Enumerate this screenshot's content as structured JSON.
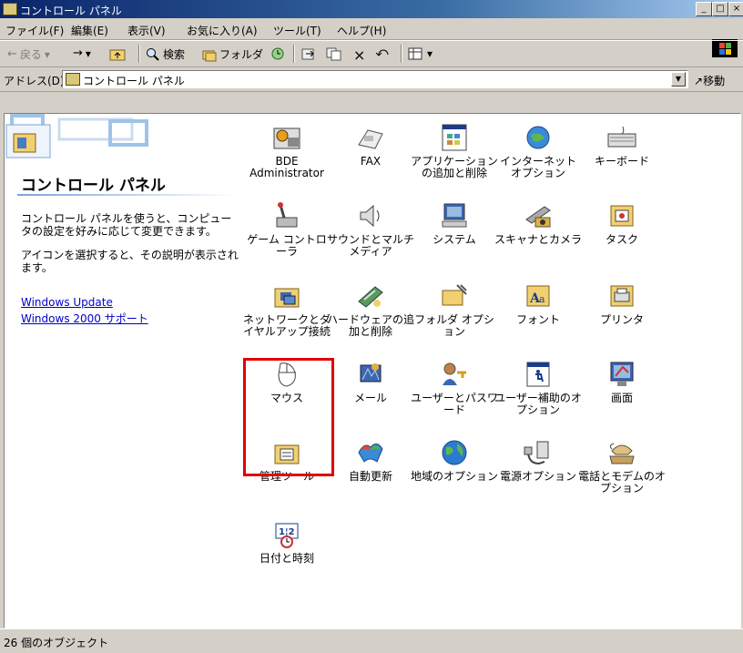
{
  "window": {
    "title": "コントロール パネル",
    "minimize": "_",
    "maximize": "□",
    "close": "×"
  },
  "menu": [
    "ファイル(F)",
    "編集(E)",
    "表示(V)",
    "お気に入り(A)",
    "ツール(T)",
    "ヘルプ(H)"
  ],
  "toolbar": {
    "back": "戻る",
    "forward": "→",
    "up": "",
    "search": "検索",
    "folders": "フォルダ",
    "history": "",
    "move_to": "",
    "copy_to": "",
    "delete": "×",
    "undo": "",
    "views": ""
  },
  "address": {
    "label": "アドレス(D)",
    "value": "コントロール パネル",
    "go": "移動"
  },
  "sidebar": {
    "title": "コントロール パネル",
    "description": "コントロール パネルを使うと、コンピュータの設定を好みに応じて変更できます。",
    "hint": "アイコンを選択すると、その説明が表示されます。",
    "links": [
      "Windows Update",
      "Windows 2000 サポート"
    ]
  },
  "items": [
    {
      "label": "BDE Administrator",
      "icon": "bde-admin-icon"
    },
    {
      "label": "FAX",
      "icon": "fax-icon"
    },
    {
      "label": "アプリケーションの追加と削除",
      "icon": "add-remove-programs-icon"
    },
    {
      "label": "インターネット オプション",
      "icon": "internet-options-icon"
    },
    {
      "label": "キーボード",
      "icon": "keyboard-icon"
    },
    {
      "label": "ゲーム コントローラ",
      "icon": "game-controller-icon"
    },
    {
      "label": "サウンドとマルチメディア",
      "icon": "sound-icon"
    },
    {
      "label": "システム",
      "icon": "system-icon"
    },
    {
      "label": "スキャナとカメラ",
      "icon": "scanner-camera-icon"
    },
    {
      "label": "タスク",
      "icon": "tasks-icon"
    },
    {
      "label": "ネットワークとダイヤルアップ接続",
      "icon": "network-dialup-icon"
    },
    {
      "label": "ハードウェアの追加と削除",
      "icon": "add-hardware-icon"
    },
    {
      "label": "フォルダ オプション",
      "icon": "folder-options-icon"
    },
    {
      "label": "フォント",
      "icon": "fonts-icon"
    },
    {
      "label": "プリンタ",
      "icon": "printers-icon"
    },
    {
      "label": "マウス",
      "icon": "mouse-icon"
    },
    {
      "label": "メール",
      "icon": "mail-icon"
    },
    {
      "label": "ユーザーとパスワード",
      "icon": "users-passwords-icon"
    },
    {
      "label": "ユーザー補助のオプション",
      "icon": "accessibility-icon"
    },
    {
      "label": "画面",
      "icon": "display-icon"
    },
    {
      "label": "管理ツール",
      "icon": "admin-tools-icon"
    },
    {
      "label": "自動更新",
      "icon": "automatic-updates-icon"
    },
    {
      "label": "地域のオプション",
      "icon": "regional-options-icon"
    },
    {
      "label": "電源オプション",
      "icon": "power-options-icon"
    },
    {
      "label": "電話とモデムのオプション",
      "icon": "phone-modem-icon"
    },
    {
      "label": "日付と時刻",
      "icon": "date-time-icon"
    }
  ],
  "status": "26 個のオブジェクト",
  "colors": {
    "title_start": "#0a246a",
    "title_end": "#a6caf0",
    "highlight": "#e00000",
    "link": "#0000cc"
  }
}
